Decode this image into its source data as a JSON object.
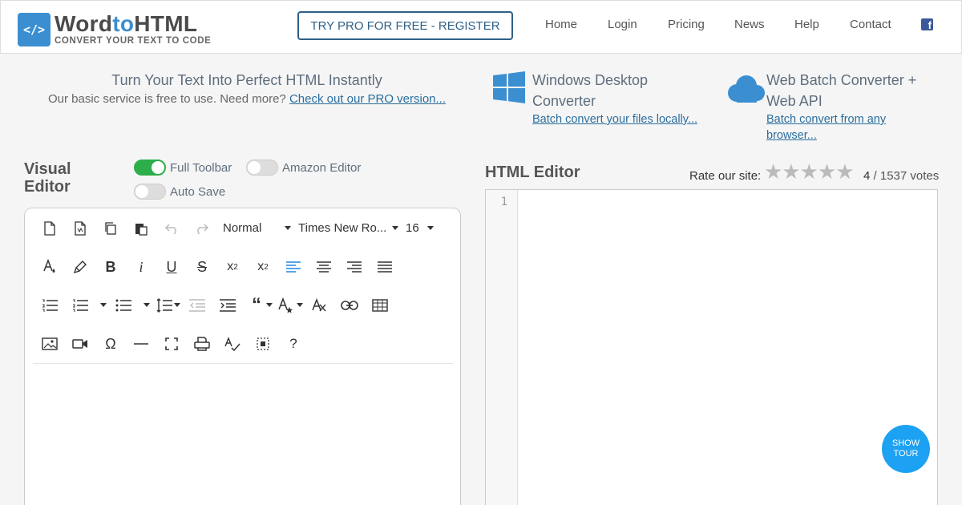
{
  "header": {
    "logo_glyph": "</>",
    "logo_word": "Word",
    "logo_to": "to",
    "logo_html": "HTML",
    "logo_tagline": "CONVERT YOUR TEXT TO CODE",
    "pro_button": "TRY PRO FOR FREE - REGISTER",
    "nav": [
      "Home",
      "Login",
      "Pricing",
      "News",
      "Help",
      "Contact"
    ],
    "facebook_icon": "facebook-icon"
  },
  "promo": {
    "title": "Turn Your Text Into Perfect HTML Instantly",
    "subtitle": "Our basic service is free to use. Need more?",
    "subtitle_link": "Check out our PRO version..."
  },
  "features": [
    {
      "title_line1": "Windows Desktop",
      "title_line2": "Converter",
      "link": "Batch convert your files locally...",
      "icon": "windows-icon"
    },
    {
      "title_line1": "Web Batch Converter +",
      "title_line2": "Web API",
      "link_line1": "Batch convert from any",
      "link_line2": "browser...",
      "icon": "cloud-icon"
    }
  ],
  "visual_editor": {
    "title_line1": "Visual",
    "title_line2": "Editor",
    "toggles": [
      {
        "label": "Full Toolbar",
        "on": true
      },
      {
        "label": "Amazon Editor",
        "on": false
      },
      {
        "label": "Auto Save",
        "on": false
      }
    ],
    "toolbar": {
      "paragraph_format": "Normal",
      "font_family": "Times New Ro...",
      "font_size": "16"
    }
  },
  "html_editor": {
    "title": "HTML Editor",
    "rate_label": "Rate our site:",
    "stars": "★★★★★",
    "rating": "4",
    "votes": "/ 1537 votes",
    "line_number": "1"
  },
  "tour_button": {
    "line1": "SHOW",
    "line2": "TOUR"
  },
  "colors": {
    "accent": "#3b8fd1",
    "toggle_on": "#2cae4a",
    "tour": "#1da1f2",
    "active_icon": "#1e88e5"
  }
}
